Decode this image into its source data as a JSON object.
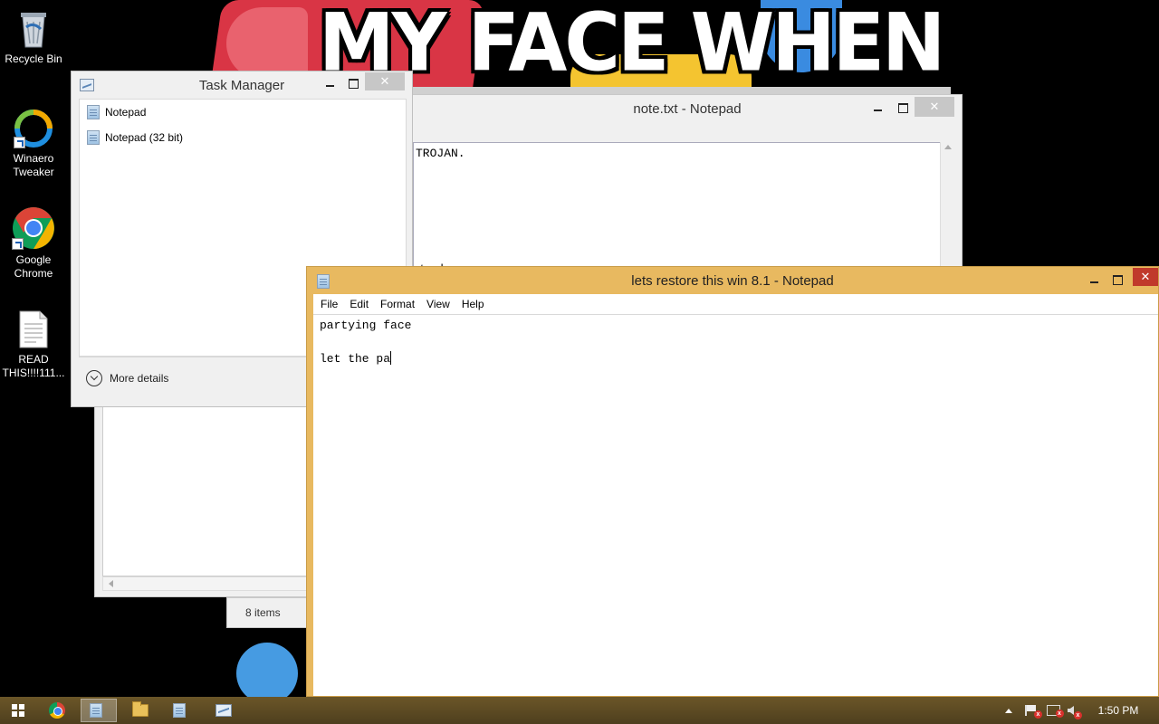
{
  "wallpaper": {
    "caption": "MY FACE WHEN"
  },
  "desktop_icons": [
    {
      "name": "Recycle Bin",
      "icon": "recycle-bin-icon"
    },
    {
      "name": "Winaero\nTweaker",
      "icon": "winaero-tweaker-icon"
    },
    {
      "name": "Google\nChrome",
      "icon": "chrome-icon"
    },
    {
      "name": "READ\nTHIS!!!!111...",
      "icon": "text-file-icon"
    }
  ],
  "task_manager": {
    "title": "Task Manager",
    "apps": [
      "Notepad",
      "Notepad (32 bit)"
    ],
    "more_details": "More details",
    "close_glyph": "✕"
  },
  "back_notepad": {
    "title": "note.txt - Notepad",
    "visible_text_top": "TROJAN.",
    "visible_text_partial": "to be"
  },
  "explorer_back": {
    "status": "8 items"
  },
  "front_notepad": {
    "title": "lets restore this win 8.1 - Notepad",
    "menu": [
      "File",
      "Edit",
      "Format",
      "View",
      "Help"
    ],
    "lines": [
      "partying face",
      "",
      "let the pa"
    ],
    "close_glyph": "✕"
  },
  "taskbar": {
    "clock": "1:50 PM",
    "colors": {
      "taskbar": "#5c4a22",
      "notepad_frame": "#e8b960",
      "close_red": "#c0392b"
    }
  }
}
